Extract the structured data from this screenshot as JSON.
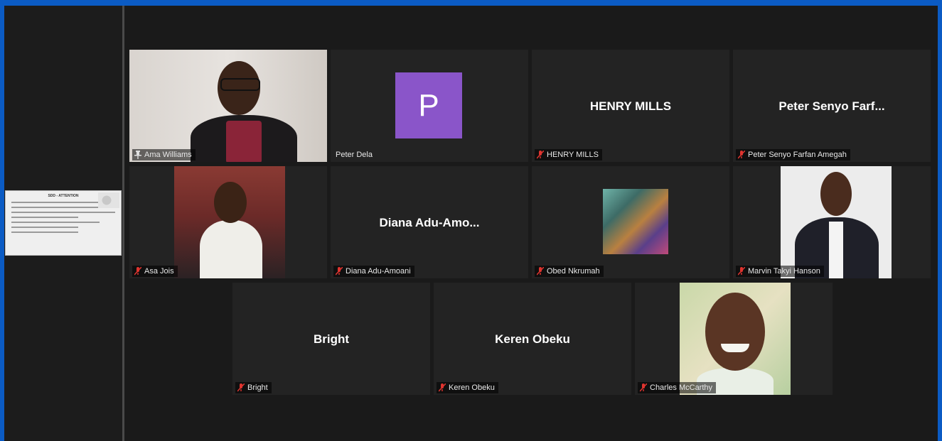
{
  "shared_screen": {
    "title": "SDD - ATTENTION"
  },
  "participants": [
    {
      "id": "ama",
      "label": "Ama Williams",
      "label_icon": "pin-icon",
      "display": "video",
      "active_speaker": true
    },
    {
      "id": "peter-dela",
      "label": "Peter Dela",
      "label_icon": "none",
      "display": "avatar",
      "avatar_letter": "P",
      "avatar_color": "#8a55c9"
    },
    {
      "id": "henry",
      "label": "HENRY MILLS",
      "label_icon": "muted-mic-icon",
      "display": "name",
      "big_name": "HENRY MILLS"
    },
    {
      "id": "peter-senyo",
      "label": "Peter Senyo Farfan Amegah",
      "label_icon": "muted-mic-icon",
      "display": "name",
      "big_name": "Peter Senyo Farf..."
    },
    {
      "id": "asa",
      "label": "Asa Jois",
      "label_icon": "muted-mic-icon",
      "display": "video"
    },
    {
      "id": "diana",
      "label": "Diana Adu-Amoani",
      "label_icon": "muted-mic-icon",
      "display": "name",
      "big_name": "Diana  Adu-Amo..."
    },
    {
      "id": "obed",
      "label": "Obed Nkrumah",
      "label_icon": "muted-mic-icon",
      "display": "picture"
    },
    {
      "id": "marvin",
      "label": "Marvin Takyi Hanson",
      "label_icon": "muted-mic-icon",
      "display": "picture"
    },
    {
      "id": "bright",
      "label": "Bright",
      "label_icon": "muted-mic-icon",
      "display": "name",
      "big_name": "Bright"
    },
    {
      "id": "keren",
      "label": "Keren Obeku",
      "label_icon": "muted-mic-icon",
      "display": "name",
      "big_name": "Keren Obeku"
    },
    {
      "id": "charles",
      "label": "Charles McCarthy",
      "label_icon": "muted-mic-icon",
      "display": "picture"
    }
  ],
  "colors": {
    "window_frame": "#0b5bc4",
    "tile_background": "#232323",
    "active_speaker_border": "#c7e36a",
    "muted_icon": "#e0342f"
  }
}
